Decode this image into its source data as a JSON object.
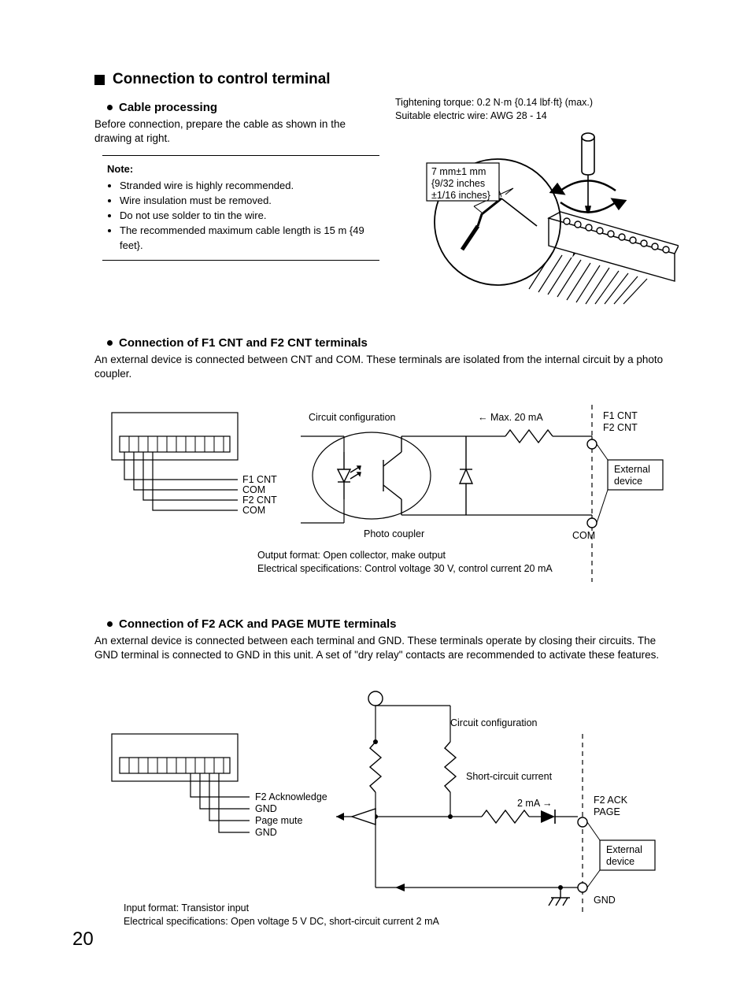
{
  "page_number": "20",
  "h1": "Connection to control terminal",
  "section1": {
    "h2": "Cable processing",
    "body": "Before connection, prepare the cable as shown in the drawing at right.",
    "note_title": "Note:",
    "notes": [
      "Stranded wire is highly recommended.",
      "Wire insulation must be removed.",
      "Do not use solder to tin the wire.",
      "The recommended maximum cable length is 15 m {49 feet}."
    ],
    "right_line1": "Tightening torque: 0.2 N·m {0.14 lbf·ft} (max.)",
    "right_line2": "Suitable electric wire: AWG 28 - 14",
    "callout_l1": "7 mm±1 mm",
    "callout_l2": "{9/32 inches",
    "callout_l3": "±1/16 inches}"
  },
  "section2": {
    "h2": "Connection of F1 CNT and F2 CNT terminals",
    "body": "An external device is connected between CNT and COM. These terminals are isolated from the internal circuit by a photo coupler.",
    "labels": {
      "circuit_config": "Circuit configuration",
      "max_current": "← Max. 20 mA",
      "f1cnt": "F1 CNT",
      "f2cnt": "F2 CNT",
      "com": "COM",
      "ext_l1": "External",
      "ext_l2": "device",
      "photo_coupler": "Photo coupler",
      "spec1": "Output format: Open collector, make output",
      "spec2": "Electrical specifications: Control voltage 30 V, control current 20 mA"
    }
  },
  "section3": {
    "h2": "Connection of F2 ACK and PAGE MUTE terminals",
    "body": "An external device is connected between each terminal and GND. These terminals operate by closing their circuits. The GND terminal is connected to GND in this unit. A set of \"dry relay\" contacts are recommended to activate these features.",
    "labels": {
      "circuit_config": "Circuit configuration",
      "short_circuit": "Short-circuit current",
      "two_ma": "2 mA →",
      "f2ack": "F2 ACK",
      "page": "PAGE",
      "f2_ack_long": "F2 Acknowledge",
      "gnd": "GND",
      "page_mute": "Page mute",
      "ext_l1": "External",
      "ext_l2": "device",
      "spec1": "Input format: Transistor input",
      "spec2": "Electrical specifications: Open voltage 5 V DC, short-circuit current 2 mA"
    }
  }
}
